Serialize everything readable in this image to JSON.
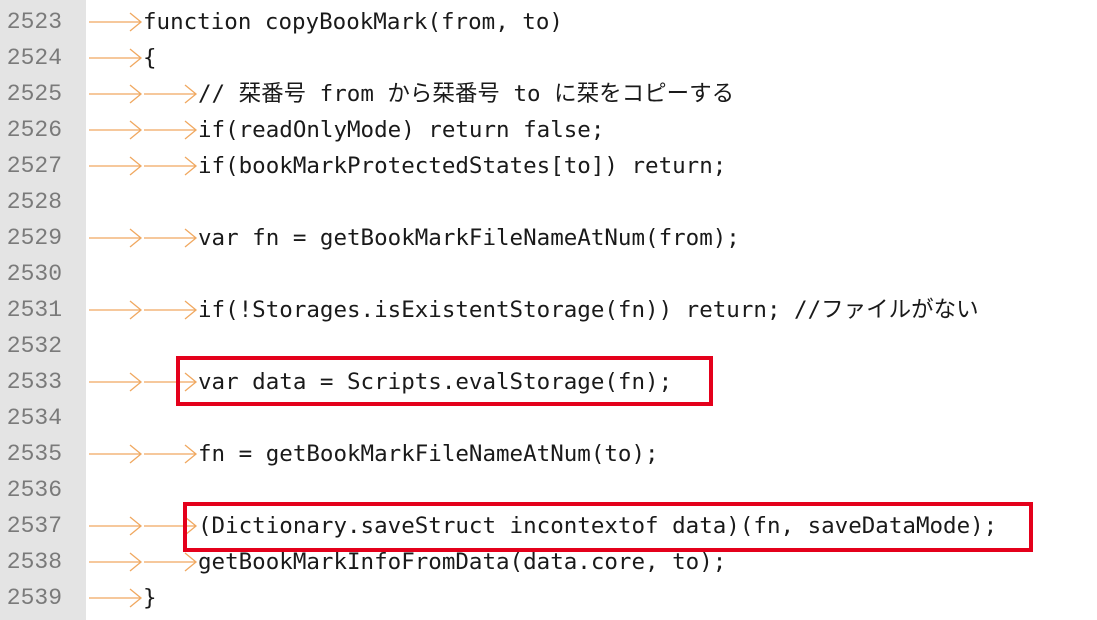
{
  "editor": {
    "lines": [
      {
        "num": "2523",
        "indent": 1,
        "code": "function copyBookMark(from, to)"
      },
      {
        "num": "2524",
        "indent": 1,
        "code": "{"
      },
      {
        "num": "2525",
        "indent": 2,
        "code": "// 栞番号 from から栞番号 to に栞をコピーする"
      },
      {
        "num": "2526",
        "indent": 2,
        "code": "if(readOnlyMode) return false;"
      },
      {
        "num": "2527",
        "indent": 2,
        "code": "if(bookMarkProtectedStates[to]) return;"
      },
      {
        "num": "2528",
        "indent": 0,
        "code": ""
      },
      {
        "num": "2529",
        "indent": 2,
        "code": "var fn = getBookMarkFileNameAtNum(from);"
      },
      {
        "num": "2530",
        "indent": 0,
        "code": ""
      },
      {
        "num": "2531",
        "indent": 2,
        "code": "if(!Storages.isExistentStorage(fn)) return; //ファイルがない"
      },
      {
        "num": "2532",
        "indent": 0,
        "code": ""
      },
      {
        "num": "2533",
        "indent": 2,
        "code": "var data = Scripts.evalStorage(fn);"
      },
      {
        "num": "2534",
        "indent": 0,
        "code": ""
      },
      {
        "num": "2535",
        "indent": 2,
        "code": "fn = getBookMarkFileNameAtNum(to);"
      },
      {
        "num": "2536",
        "indent": 0,
        "code": ""
      },
      {
        "num": "2537",
        "indent": 2,
        "code": "(Dictionary.saveStruct incontextof data)(fn, saveDataMode);"
      },
      {
        "num": "2538",
        "indent": 2,
        "code": "getBookMarkInfoFromData(data.core, to);"
      },
      {
        "num": "2539",
        "indent": 1,
        "code": "}"
      }
    ],
    "highlight_color": "#e4001b",
    "tab_arrow_color": "#f0a860",
    "gutter_color": "#e4e4e4"
  }
}
